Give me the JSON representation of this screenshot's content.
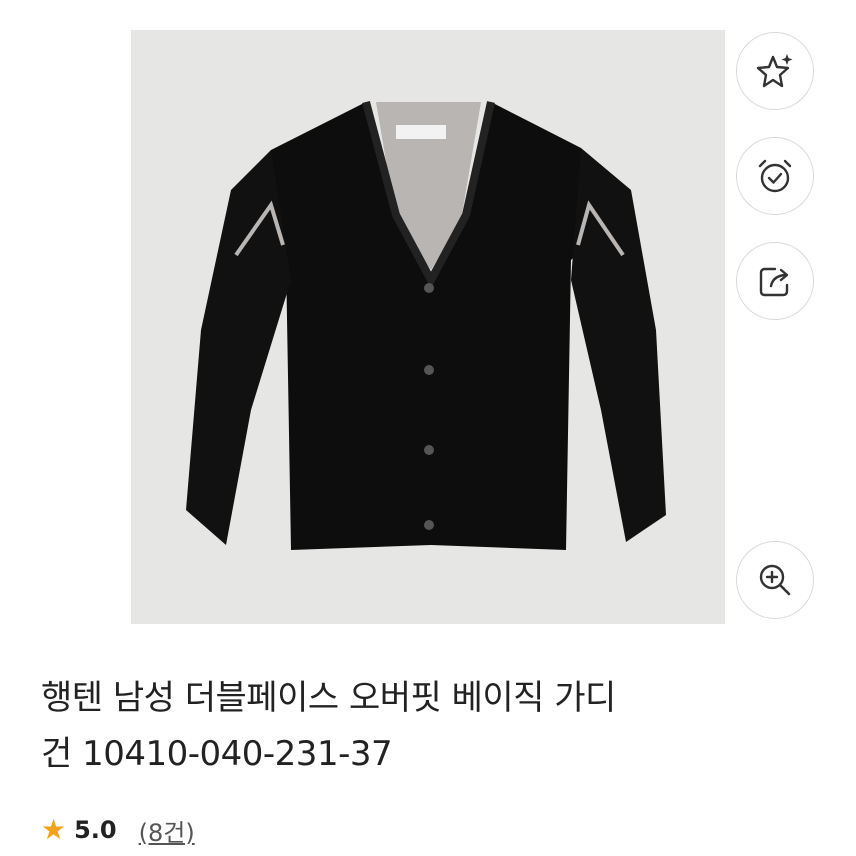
{
  "product": {
    "image_alt": "black v-neck cardigan with grey lining",
    "title_line1": "행텐 남성 더블페이스 오버핏 베이직 가디",
    "title_line2": "건 10410-040-231-37",
    "rating": {
      "icon": "star-icon",
      "score": "5.0",
      "review_count": "(8건)"
    }
  },
  "actions": {
    "favorite_icon": "star-sparkle-icon",
    "alarm_icon": "alarm-clock-check-icon",
    "share_icon": "share-icon",
    "zoom_icon": "zoom-in-icon"
  },
  "colors": {
    "accent_star": "#f2a31b",
    "photo_bg": "#e6e6e4",
    "icon_stroke": "#333333"
  }
}
